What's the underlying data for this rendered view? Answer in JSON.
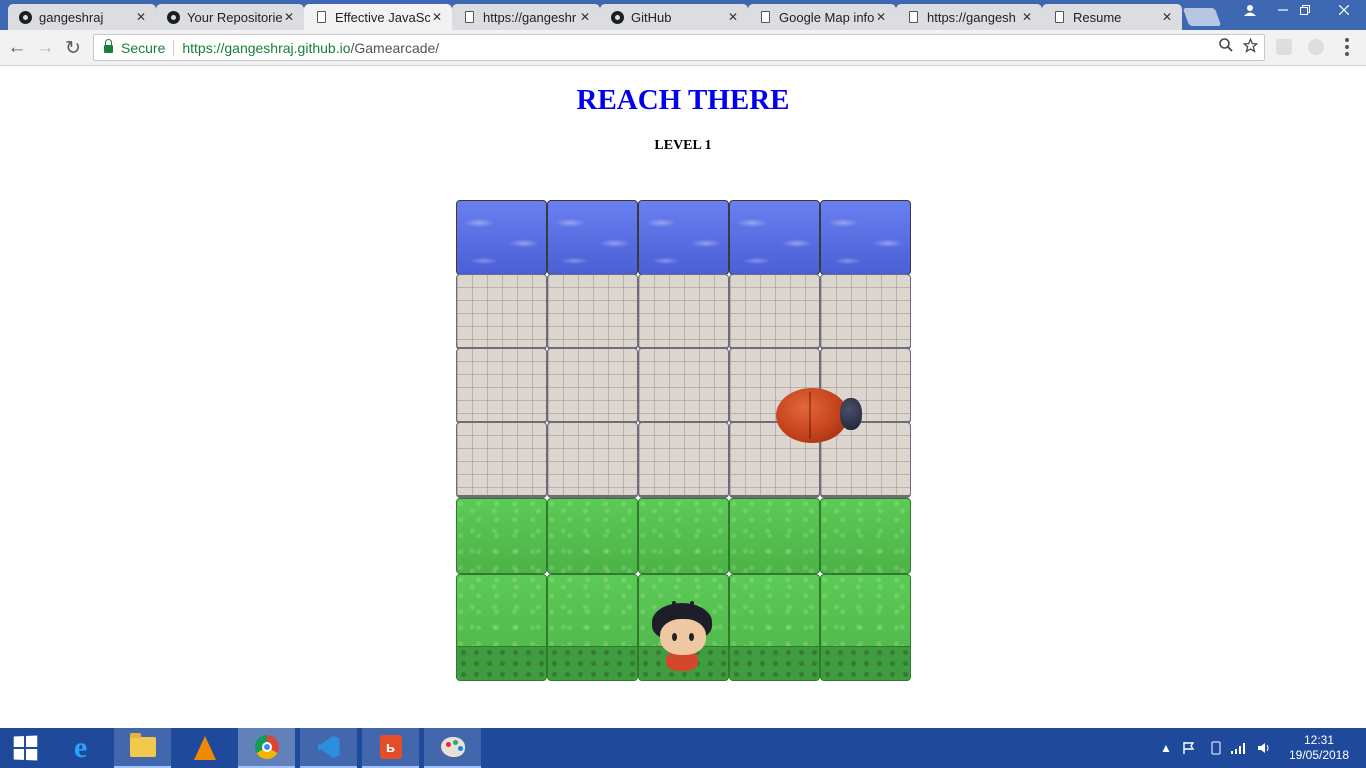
{
  "browser": {
    "tabs": [
      {
        "title": "gangeshraj",
        "icon": "github-icon",
        "active": false
      },
      {
        "title": "Your Repositorie",
        "icon": "github-icon",
        "active": false
      },
      {
        "title": "Effective JavaScr",
        "icon": "document-icon",
        "active": true
      },
      {
        "title": "https://gangeshr",
        "icon": "document-icon",
        "active": false
      },
      {
        "title": "GitHub",
        "icon": "github-icon",
        "active": false
      },
      {
        "title": "Google Map info",
        "icon": "document-icon",
        "active": false
      },
      {
        "title": "https://gangesh",
        "icon": "document-icon",
        "active": false
      },
      {
        "title": "Resume",
        "icon": "document-icon",
        "active": false
      }
    ],
    "close_glyph": "✕",
    "address": {
      "secure_label": "Secure",
      "host": "https://gangeshraj.github.io",
      "path": "/Gamearcade/"
    }
  },
  "page": {
    "title": "REACH THERE",
    "level": "LEVEL 1",
    "title_color": "#0000ee",
    "board": {
      "columns": 5,
      "rows": [
        "water",
        "stone",
        "stone",
        "stone",
        "grass",
        "grass"
      ],
      "enemy": "bug",
      "player": "boy"
    }
  },
  "taskbar": {
    "apps": [
      "start-button",
      "internet-explorer-icon",
      "file-explorer-icon",
      "vlc-icon",
      "chrome-icon",
      "vscode-icon",
      "acrobat-icon",
      "paint-icon"
    ],
    "time": "12:31",
    "date": "19/05/2018",
    "tray_arrow": "▲"
  },
  "colors": {
    "titlebar": "#3d67b0",
    "taskbar": "#1f4a9c",
    "secure": "#188038"
  }
}
